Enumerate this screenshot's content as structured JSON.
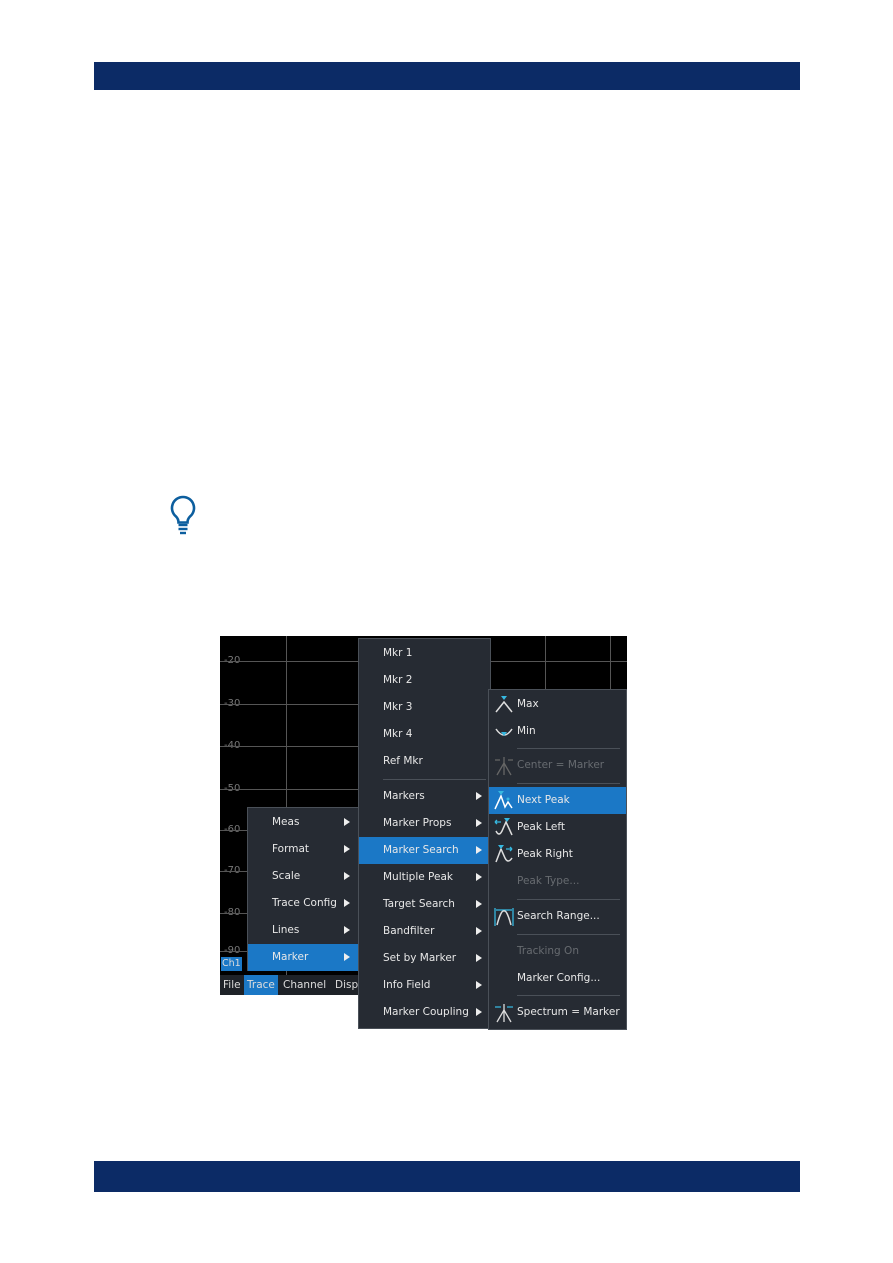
{
  "graph": {
    "y_labels": [
      "-20",
      "-30",
      "-40",
      "-50",
      "-60",
      "-70",
      "-80",
      "-90"
    ],
    "channel": "Ch1"
  },
  "menubar": [
    "File",
    "Trace",
    "Channel",
    "Displa"
  ],
  "trace_menu": [
    {
      "label": "Meas",
      "sub": true
    },
    {
      "label": "Format",
      "sub": true
    },
    {
      "label": "Scale",
      "sub": true
    },
    {
      "label": "Trace Config",
      "sub": true
    },
    {
      "label": "Lines",
      "sub": true
    },
    {
      "label": "Marker",
      "sub": true,
      "selected": true
    }
  ],
  "marker_menu": [
    {
      "label": "Mkr 1"
    },
    {
      "label": "Mkr 2"
    },
    {
      "label": "Mkr 3"
    },
    {
      "label": "Mkr 4"
    },
    {
      "label": "Ref Mkr"
    },
    {
      "label": "Markers",
      "sub": true
    },
    {
      "label": "Marker Props",
      "sub": true
    },
    {
      "label": "Marker Search",
      "sub": true,
      "selected": true
    },
    {
      "label": "Multiple Peak",
      "sub": true
    },
    {
      "label": "Target Search",
      "sub": true
    },
    {
      "label": "Bandfilter",
      "sub": true
    },
    {
      "label": "Set by Marker",
      "sub": true
    },
    {
      "label": "Info Field",
      "sub": true
    },
    {
      "label": "Marker Coupling",
      "sub": true
    }
  ],
  "search_menu": [
    {
      "label": "Max",
      "icon": "max-icon"
    },
    {
      "label": "Min",
      "icon": "min-icon"
    },
    {
      "label": "Center = Marker",
      "icon": "center-marker-icon",
      "disabled": true
    },
    {
      "label": "Next Peak",
      "icon": "next-peak-icon",
      "selected": true
    },
    {
      "label": "Peak Left",
      "icon": "peak-left-icon"
    },
    {
      "label": "Peak Right",
      "icon": "peak-right-icon"
    },
    {
      "label": "Peak Type...",
      "disabled": true
    },
    {
      "label": "Search Range...",
      "icon": "search-range-icon"
    },
    {
      "label": "Tracking On",
      "disabled": true
    },
    {
      "label": "Marker Config..."
    },
    {
      "label": "Spectrum = Marker",
      "icon": "spectrum-marker-icon"
    }
  ],
  "colors": {
    "header": "#0c2b66",
    "highlight": "#1b78c6",
    "menu_bg": "#262b33",
    "icon_accent": "#36b8e0"
  }
}
